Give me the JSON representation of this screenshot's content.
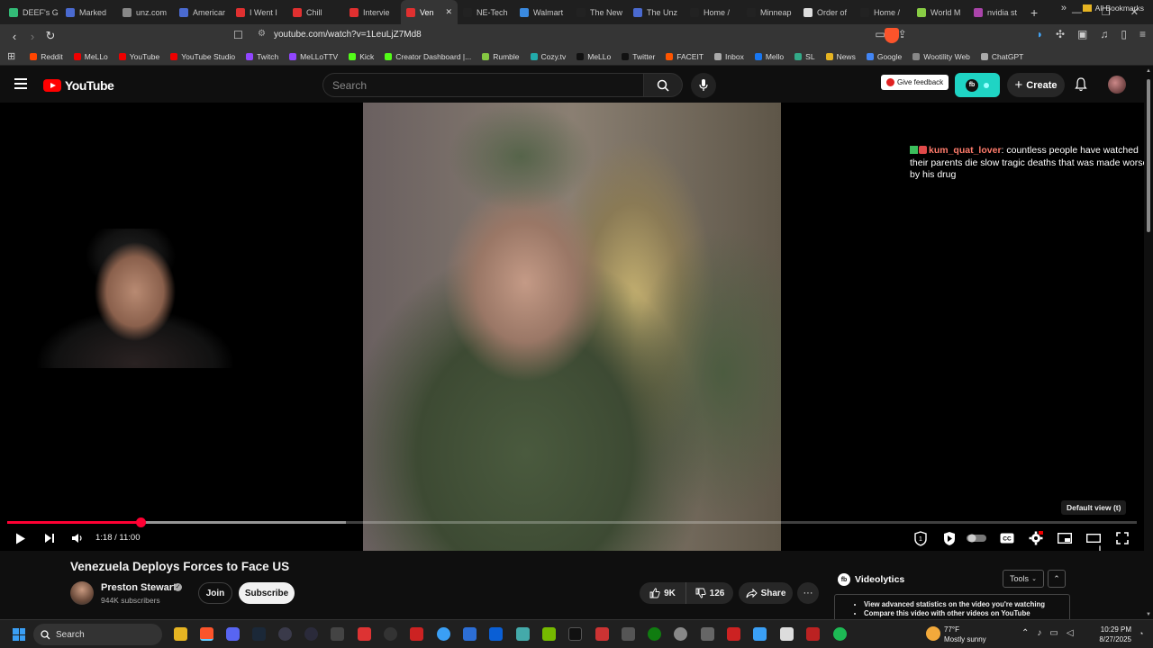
{
  "browser": {
    "tabs": [
      {
        "label": "DEEF's G",
        "color": "#3b7"
      },
      {
        "label": "Marked",
        "color": "#4a6ad0"
      },
      {
        "label": "unz.com",
        "color": "#888"
      },
      {
        "label": "Americar",
        "color": "#4a6ad0"
      },
      {
        "label": "I Went I",
        "color": "#e03030"
      },
      {
        "label": "Chill",
        "color": "#e03030"
      },
      {
        "label": "Intervie",
        "color": "#e03030"
      },
      {
        "label": "Ven",
        "color": "#e03030",
        "active": true
      },
      {
        "label": "NE-Tech",
        "color": "#222"
      },
      {
        "label": "Walmart",
        "color": "#3a8ae0"
      },
      {
        "label": "The New",
        "color": "#222"
      },
      {
        "label": "The Unz",
        "color": "#4a6ad0"
      },
      {
        "label": "Home /",
        "color": "#222"
      },
      {
        "label": "Minneap",
        "color": "#222"
      },
      {
        "label": "Order of",
        "color": "#ddd"
      },
      {
        "label": "Home /",
        "color": "#222"
      },
      {
        "label": "World M",
        "color": "#8c4"
      },
      {
        "label": "nvidia st",
        "color": "#a4a"
      }
    ],
    "new_tab": "+",
    "window_controls": {
      "minimize": "—",
      "restore": "❐",
      "close": "✕"
    },
    "url": "youtube.com/watch?v=1LeuLjZ7Md8",
    "bookmarks": [
      {
        "label": "Reddit",
        "color": "#ff4500"
      },
      {
        "label": "MeLLo",
        "color": "#e00"
      },
      {
        "label": "YouTube",
        "color": "#e00"
      },
      {
        "label": "YouTube Studio",
        "color": "#e00"
      },
      {
        "label": "Twitch",
        "color": "#9146ff"
      },
      {
        "label": "MeLLoTTV",
        "color": "#9146ff"
      },
      {
        "label": "Kick",
        "color": "#53fc18"
      },
      {
        "label": "Creator Dashboard |...",
        "color": "#53fc18"
      },
      {
        "label": "Rumble",
        "color": "#85c742"
      },
      {
        "label": "Cozy.tv",
        "color": "#2aa"
      },
      {
        "label": "MeLLo",
        "color": "#111"
      },
      {
        "label": "Twitter",
        "color": "#111"
      },
      {
        "label": "FACEIT",
        "color": "#f50"
      },
      {
        "label": "Inbox",
        "color": "#aaa"
      },
      {
        "label": "Mello",
        "color": "#1877f2"
      },
      {
        "label": "SL",
        "color": "#3a8"
      },
      {
        "label": "News",
        "color": "#e6b422"
      },
      {
        "label": "Google",
        "color": "#4285f4"
      },
      {
        "label": "Wootility Web",
        "color": "#888"
      },
      {
        "label": "ChatGPT",
        "color": "#aaa"
      }
    ],
    "all_bookmarks": "All Bookmarks",
    "more": "»"
  },
  "youtube": {
    "logo_text": "YouTube",
    "search_placeholder": "Search",
    "give_feedback": "Give feedback",
    "ext_badge": "fb",
    "create_label": "Create",
    "create_plus": "+"
  },
  "player": {
    "chat": {
      "user": "kum_quat_lover",
      "message": ": countless people have watched their parents die slow tragic deaths that was made worse by his drug"
    },
    "tooltip": "Default view (t)",
    "time_current": "1:18",
    "time_total": "11:00",
    "time_display": "1:18 / 11:00",
    "progress_played": 0.118,
    "progress_buffered": 0.3
  },
  "video": {
    "title": "Venezuela Deploys Forces to Face US",
    "channel": "Preston Stewart",
    "subscribers": "944K subscribers",
    "join_label": "Join",
    "subscribe_label": "Subscribe",
    "likes": "9K",
    "dislikes": "126",
    "share_label": "Share",
    "more_label": "···"
  },
  "videolytics": {
    "name": "Videolytics",
    "logo": "fb",
    "tools_label": "Tools",
    "items": [
      "View advanced statistics on the video you're watching",
      "Compare this video with other videos on YouTube"
    ]
  },
  "taskbar": {
    "search_label": "Search",
    "temp": "77°F",
    "condition": "Mostly sunny",
    "time": "10:29 PM",
    "date": "8/27/2025"
  }
}
